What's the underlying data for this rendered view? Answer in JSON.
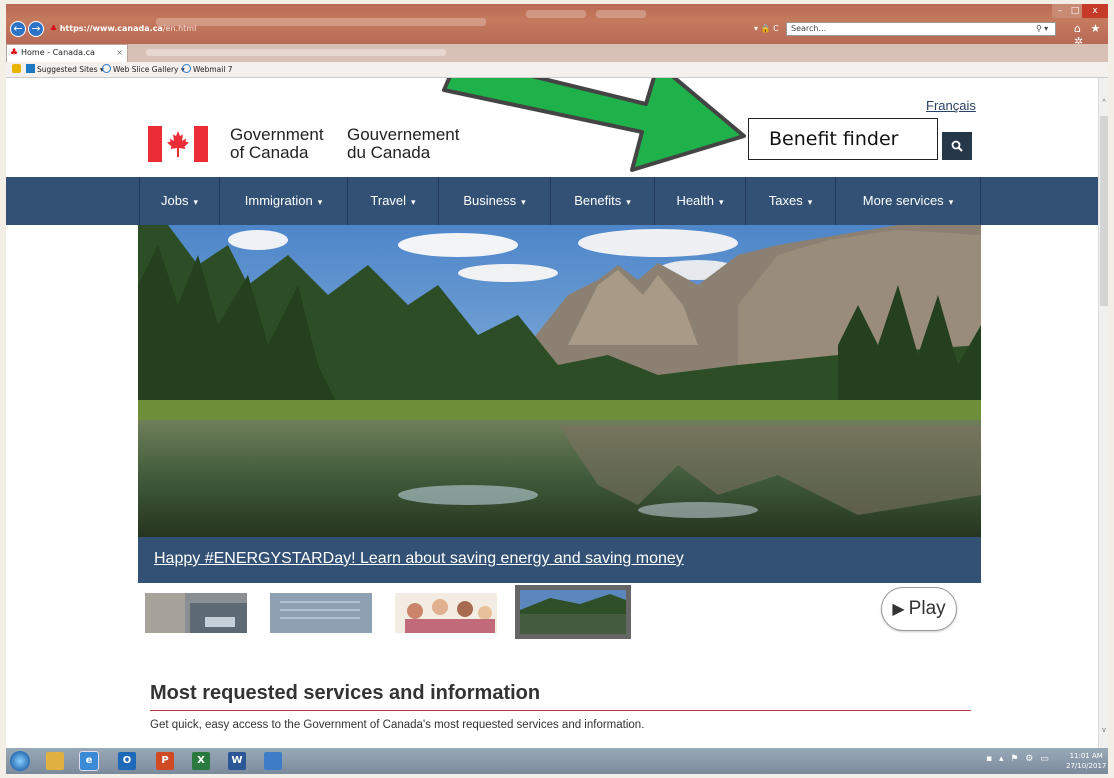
{
  "browser": {
    "address_host": "https://www.canada.ca",
    "address_path": "/en.html",
    "address_controls": "▾ 🔒 C",
    "search_placeholder": "Search...",
    "tab_title": "Home - Canada.ca",
    "tab_close": "×",
    "favorites": [
      {
        "label": "Suggested Sites ▾"
      },
      {
        "label": "Web Slice Gallery ▾"
      },
      {
        "label": "Webmail 7"
      }
    ],
    "window_controls": {
      "minimize": "–",
      "maximize": "□",
      "close": "x"
    },
    "toolbar_icons": "⌂ ★ ✲"
  },
  "header": {
    "language_link": "Français",
    "wordmark_en_line1": "Government",
    "wordmark_en_line2": "of Canada",
    "wordmark_fr_line1": "Gouvernement",
    "wordmark_fr_line2": "du Canada",
    "search_value": "Benefit finder",
    "search_button_icon": "search-icon"
  },
  "menu": {
    "items": [
      {
        "label": "Jobs"
      },
      {
        "label": "Immigration"
      },
      {
        "label": "Travel"
      },
      {
        "label": "Business"
      },
      {
        "label": "Benefits"
      },
      {
        "label": "Health"
      },
      {
        "label": "Taxes"
      },
      {
        "label": "More services"
      }
    ],
    "chevron": "▾"
  },
  "hero": {
    "caption": "Happy #ENERGYSTARDay! Learn about saving energy and saving money",
    "play_label": "Play",
    "carousel_active_index": 3,
    "carousel_count": 4
  },
  "services": {
    "title": "Most requested services and information",
    "description": "Get quick, easy access to the Government of Canada's most requested services and information."
  },
  "taskbar": {
    "time": "11:01 AM",
    "date": "27/10/2017",
    "apps": [
      "windows-explorer",
      "internet-explorer",
      "outlook",
      "powerpoint",
      "excel",
      "word",
      "other-app"
    ]
  },
  "colors": {
    "gc_blue": "#335075",
    "gc_dark": "#26374a",
    "flag_red": "#eb2d37",
    "annotation_arrow": "#1fb14a"
  }
}
